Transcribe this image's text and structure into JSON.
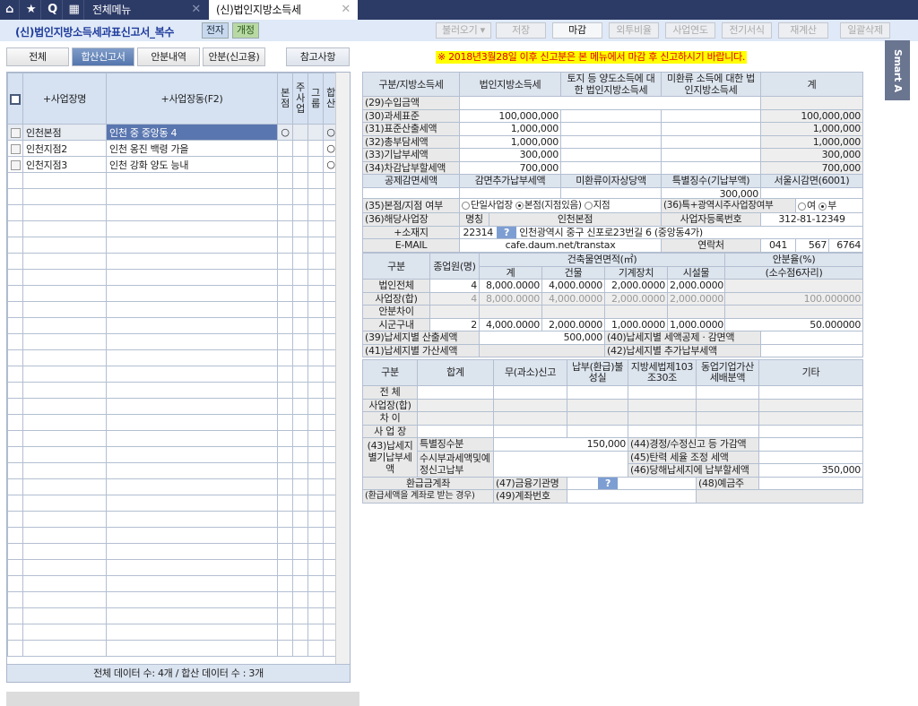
{
  "topbar": {
    "menu_tab": "전체메뉴",
    "active_tab": "(신)법인지방소득세",
    "home": "⌂",
    "star": "★",
    "search": "Q",
    "grid": "▦",
    "close": "✕"
  },
  "header": {
    "title": "(신)법인지방소득세과표신고서_복수",
    "badge_e": "전자",
    "badge_rev": "개정"
  },
  "toolbar": {
    "load": "불러오기 ▾",
    "save": "저장",
    "close_deadline": "마감",
    "ratio": "외투비율",
    "biz_year": "사업연도",
    "e_form": "전기서식",
    "recalc": "재계산",
    "delete_all": "일괄삭제"
  },
  "nav": {
    "all": "전체",
    "combined": "합산신고서",
    "alloc": "안분내역",
    "alloc_report": "안분(신고용)",
    "reference": "참고사항"
  },
  "notice": "※ 2018년3월28일 이후 신고분은 본 메뉴에서 마감 후 신고하시기 바랍니다.",
  "smart": "Smart A",
  "list": {
    "headers": {
      "name": "+사업장명",
      "dong": "+사업장동(F2)",
      "hq": "본점",
      "main": "주사업",
      "group": "그룹",
      "sum": "합산"
    },
    "rows": [
      {
        "name": "인천본점",
        "dong": "인천  중  중앙동 4",
        "hq": "○",
        "sum": "○"
      },
      {
        "name": "인천지점2",
        "dong": "인천  옹진  백령  가을",
        "hq": "",
        "sum": "○"
      },
      {
        "name": "인천지점3",
        "dong": "인천  강화  양도  능내",
        "hq": "",
        "sum": "○"
      }
    ],
    "footer": "전체 데이터 수: 4개 / 합산 데이터 수 : 3개"
  },
  "tax": {
    "h": [
      "구분/지방소득세",
      "법인지방소득세",
      "토지 등 양도소득에 대한 법인지방소득세",
      "미환류 소득에 대한 법인지방소득세",
      "계"
    ],
    "rows": [
      {
        "label": "(29)수입금액",
        "v1": "",
        "tot": ""
      },
      {
        "label": "(30)과세표준",
        "v1": "100,000,000",
        "tot": "100,000,000"
      },
      {
        "label": "(31)표준산출세액",
        "v1": "1,000,000",
        "tot": "1,000,000"
      },
      {
        "label": "(32)총부담세액",
        "v1": "1,000,000",
        "tot": "1,000,000"
      },
      {
        "label": "(33)기납부세액",
        "v1": "300,000",
        "tot": "300,000"
      },
      {
        "label": "(34)차감납부할세액",
        "v1": "700,000",
        "tot": "700,000"
      }
    ],
    "h2": [
      "공제감면세액",
      "감면추가납부세액",
      "미환류이자상당액",
      "특별징수(기납부액)",
      "서울시감면(6001)"
    ],
    "special": "300,000"
  },
  "info": {
    "l35": "(35)본점/지점 여부",
    "opt1": "단일사업장",
    "opt2": "본점(지점있음)",
    "opt3": "지점",
    "l36a": "(36)특+광역시주사업장여부",
    "yes": "여",
    "no": "부",
    "l36": "(36)해당사업장",
    "name_l": "명칭",
    "name": "인천본점",
    "reg_l": "사업자등록번호",
    "reg": "312-81-12349",
    "addr_l": "+소재지",
    "zip": "22314",
    "addr": "인천광역시 중구  신포로23번길 6  (중앙동4가)",
    "email_l": "E-MAIL",
    "email": "cafe.daum.net/transtax",
    "tel_l": "연락처",
    "tel1": "041",
    "tel2": "567",
    "tel3": "6764",
    "q": "?"
  },
  "area": {
    "h": {
      "gubun": "구분",
      "emp": "종업원(명)",
      "bld": "건축물연면적(㎡)",
      "sum": "계",
      "b": "건물",
      "m": "기계장치",
      "f": "시설물",
      "ratio": "안분율(%)",
      "ratio2": "(소수점6자리)"
    },
    "rows": [
      {
        "label": "법인전체",
        "emp": "4",
        "sum": "8,000.0000",
        "b": "4,000.0000",
        "m": "2,000.0000",
        "f": "2,000.0000",
        "ratio": ""
      },
      {
        "label": "사업장(합)",
        "emp": "4",
        "sum": "8,000.0000",
        "b": "4,000.0000",
        "m": "2,000.0000",
        "f": "2,000.0000",
        "ratio": "100.000000"
      },
      {
        "label": "안분차이",
        "emp": "",
        "sum": "",
        "b": "",
        "m": "",
        "f": "",
        "ratio": ""
      },
      {
        "label": "시군구내",
        "emp": "2",
        "sum": "4,000.0000",
        "b": "2,000.0000",
        "m": "1,000.0000",
        "f": "1,000.0000",
        "ratio": "50.000000"
      }
    ],
    "l39": "(39)납세지별 산출세액",
    "v39": "500,000",
    "l40": "(40)납세지별 세액공제 · 감면액",
    "l41": "(41)납세지별 가산세액",
    "l42": "(42)납세지별 추가납부세액"
  },
  "pen": {
    "h": [
      "구분",
      "합계",
      "무(과소)신고",
      "납부(환급)불성실",
      "지방세법제103조30조",
      "동업기업가산세배분액",
      "기타"
    ],
    "rows": [
      "전   체",
      "사업장(합)",
      "차   이",
      "사 업 장"
    ],
    "l43": "(43)납세지별기납부세액",
    "special": "특별징수분",
    "v_special": "150,000",
    "occ": "수시부과세액및예정신고납부",
    "l44": "(44)경정/수정신고 등 가감액",
    "l45": "(45)탄력 세율 조정 세액",
    "l46": "(46)당해납세지에 납부할세액",
    "v46": "350,000",
    "refund": "환급금계좌",
    "refund2": "(환급세액을 계좌로 받는 경우)",
    "l47": "(47)금융기관명",
    "l48": "(48)예금주",
    "l49": "(49)계좌번호"
  }
}
